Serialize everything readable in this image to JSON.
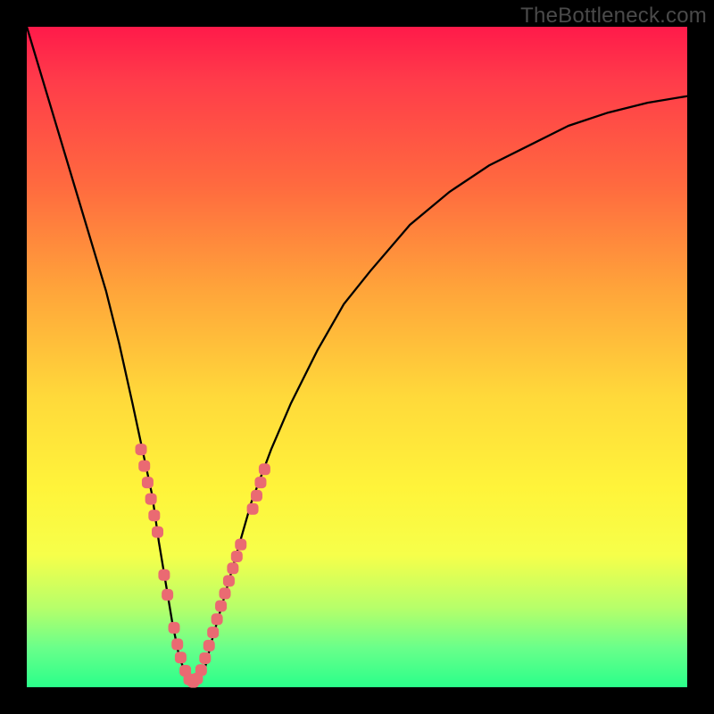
{
  "watermark": "TheBottleneck.com",
  "colors": {
    "frame_bg_top": "#ff1a4a",
    "frame_bg_bottom": "#2aff8a",
    "curve_stroke": "#000000",
    "bead_fill": "#ea6a72",
    "page_bg": "#000000"
  },
  "chart_data": {
    "type": "line",
    "title": "",
    "xlabel": "",
    "ylabel": "",
    "xlim": [
      0,
      100
    ],
    "ylim": [
      0,
      100
    ],
    "grid": false,
    "series": [
      {
        "name": "curve",
        "x": [
          0,
          3,
          6,
          9,
          12,
          14,
          16,
          17.5,
          19,
          20,
          21,
          22,
          23,
          24,
          25,
          26,
          27,
          28,
          30,
          32,
          34,
          37,
          40,
          44,
          48,
          52,
          58,
          64,
          70,
          76,
          82,
          88,
          94,
          100
        ],
        "y": [
          100,
          90,
          80,
          70,
          60,
          52,
          43,
          36,
          29,
          22,
          16,
          10,
          5,
          2,
          0.5,
          1,
          3,
          7,
          14,
          21,
          28,
          36,
          43,
          51,
          58,
          63,
          70,
          75,
          79,
          82,
          85,
          87,
          88.5,
          89.5
        ]
      }
    ],
    "annotations": {
      "beads": [
        {
          "x": 17.3,
          "y": 36
        },
        {
          "x": 17.8,
          "y": 33.5
        },
        {
          "x": 18.3,
          "y": 31
        },
        {
          "x": 18.8,
          "y": 28.5
        },
        {
          "x": 19.3,
          "y": 26
        },
        {
          "x": 19.8,
          "y": 23.5
        },
        {
          "x": 20.8,
          "y": 17
        },
        {
          "x": 21.3,
          "y": 14
        },
        {
          "x": 22.3,
          "y": 9
        },
        {
          "x": 22.8,
          "y": 6.5
        },
        {
          "x": 23.3,
          "y": 4.5
        },
        {
          "x": 24.0,
          "y": 2.5
        },
        {
          "x": 24.6,
          "y": 1.2
        },
        {
          "x": 25.2,
          "y": 0.8
        },
        {
          "x": 25.8,
          "y": 1.3
        },
        {
          "x": 26.4,
          "y": 2.6
        },
        {
          "x": 27.0,
          "y": 4.4
        },
        {
          "x": 27.6,
          "y": 6.3
        },
        {
          "x": 28.2,
          "y": 8.3
        },
        {
          "x": 28.8,
          "y": 10.3
        },
        {
          "x": 29.4,
          "y": 12.3
        },
        {
          "x": 30.0,
          "y": 14.2
        },
        {
          "x": 30.6,
          "y": 16.1
        },
        {
          "x": 31.2,
          "y": 18.0
        },
        {
          "x": 31.8,
          "y": 19.8
        },
        {
          "x": 32.4,
          "y": 21.6
        },
        {
          "x": 34.2,
          "y": 27
        },
        {
          "x": 34.8,
          "y": 29
        },
        {
          "x": 35.4,
          "y": 31
        },
        {
          "x": 36.0,
          "y": 33
        }
      ]
    }
  }
}
